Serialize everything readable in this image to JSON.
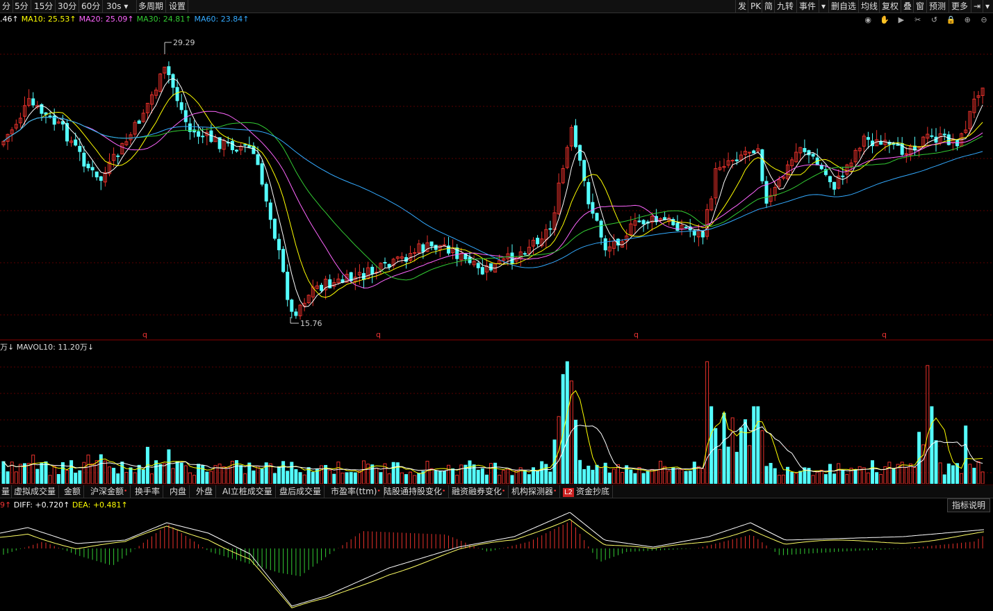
{
  "toolbar": {
    "left": [
      "分",
      "5分",
      "15分",
      "30分",
      "60分",
      "30s",
      "多周期",
      "设置"
    ],
    "right": [
      "发",
      "PK",
      "简",
      "九转",
      "事件",
      "删自选",
      "均线",
      "复权",
      "叠",
      "窗",
      "预测",
      "更多"
    ]
  },
  "ma_legend": {
    "ma5": ".46↑",
    "ma10": "MA10: 25.53↑",
    "ma20": "MA20: 25.09↑",
    "ma30": "MA30: 24.81↑",
    "ma60": "MA60: 23.84↑"
  },
  "price_labels": {
    "high": "29.29",
    "low": "15.76",
    "marker": "q"
  },
  "volume_legend": {
    "prefix": "万↓",
    "mavol10": "MAVOL10: 11.20万↓"
  },
  "indicator_tabs": [
    "量",
    "虚拟成交量",
    "金额",
    "沪深金额",
    "换手率",
    "内盘",
    "外盘",
    "AI立桩成交量",
    "盘后成交量",
    "市盈率(ttm)",
    "陆股通持股变化",
    "融资融券变化",
    "机构探测器",
    "资金抄底"
  ],
  "indicator_badge": "L2",
  "macd_legend": {
    "prefix": "9↑",
    "diff": "DIFF: +0.720↑",
    "dea": "DEA: +0.481↑"
  },
  "explain_button": "指标说明",
  "colors": {
    "up": "#e8312b",
    "down": "#54ffff",
    "ma5": "#ffffff",
    "ma10": "#ffff00",
    "ma20": "#ff66ff",
    "ma30": "#33cc33",
    "ma60": "#33aaff",
    "grid": "#5a0000"
  },
  "tools": [
    "eye-icon",
    "hand-icon",
    "play-icon",
    "scissors-icon",
    "undo-icon",
    "lock-icon",
    "zoom-in-icon",
    "zoom-out-icon"
  ]
}
